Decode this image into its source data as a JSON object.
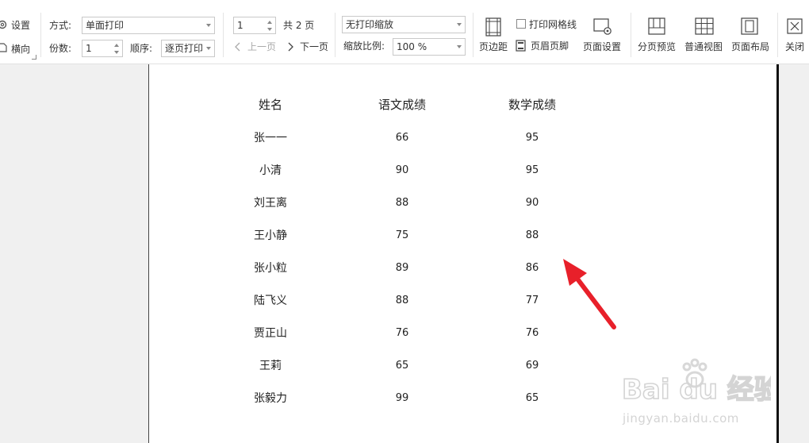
{
  "toolbar": {
    "settings_label": "设置",
    "orientation_label": "横向",
    "mode_label": "方式:",
    "mode_value": "单面打印",
    "copies_label": "份数:",
    "copies_value": "1",
    "order_label": "顺序:",
    "order_value": "逐页打印",
    "page_value": "1",
    "total_pages": "共 2 页",
    "prev_page": "上一页",
    "next_page": "下一页",
    "scaling_value": "无打印缩放",
    "zoom_label": "缩放比例:",
    "zoom_value": "100 %",
    "margins": "页边距",
    "print_gridlines": "打印网格线",
    "header_footer": "页眉页脚",
    "page_setup": "页面设置",
    "page_break_preview": "分页预览",
    "normal_view": "普通视图",
    "page_layout": "页面布局",
    "close": "关闭"
  },
  "table": {
    "headers": [
      "姓名",
      "语文成绩",
      "数学成绩"
    ],
    "rows": [
      [
        "张一一",
        "66",
        "95"
      ],
      [
        "小清",
        "90",
        "95"
      ],
      [
        "刘王离",
        "88",
        "90"
      ],
      [
        "王小静",
        "75",
        "88"
      ],
      [
        "张小粒",
        "89",
        "86"
      ],
      [
        "陆飞义",
        "88",
        "77"
      ],
      [
        "贾正山",
        "76",
        "76"
      ],
      [
        "王莉",
        "65",
        "69"
      ],
      [
        "张毅力",
        "99",
        "65"
      ]
    ]
  },
  "watermark": {
    "logo_text": "Bai du 经验",
    "url": "jingyan.baidu.com"
  },
  "colors": {
    "arrow": "#e8202a",
    "page_border": "#111111"
  }
}
